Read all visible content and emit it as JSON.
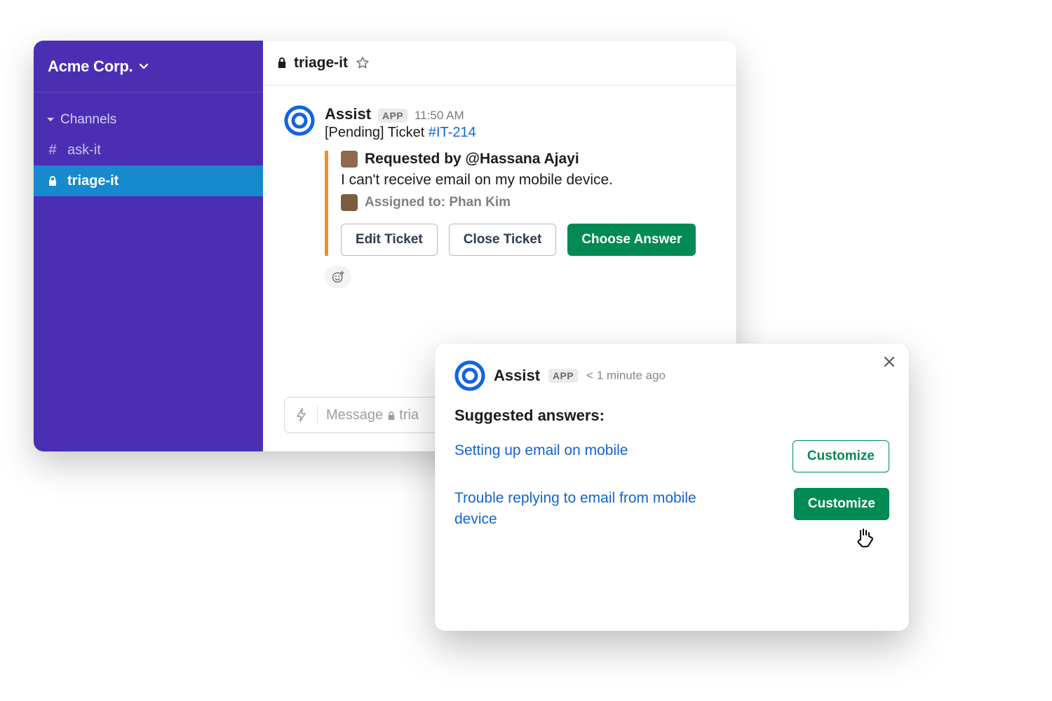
{
  "workspace": {
    "name": "Acme Corp."
  },
  "sidebar": {
    "section_label": "Channels",
    "channels": [
      {
        "name": "ask-it",
        "type": "public"
      },
      {
        "name": "triage-it",
        "type": "private"
      }
    ]
  },
  "channel_header": {
    "name": "triage-it"
  },
  "message": {
    "author": "Assist",
    "badge": "APP",
    "time": "11:50 AM",
    "status_prefix": "[Pending] Ticket ",
    "ticket_id": "#IT-214",
    "requested_label": "Requested by ",
    "requested_by": "@Hassana Ajayi",
    "issue": "I can't receive email on my mobile device.",
    "assigned_label": "Assigned to: ",
    "assigned_to": "Phan Kim",
    "buttons": {
      "edit": "Edit Ticket",
      "close": "Close Ticket",
      "choose": "Choose Answer"
    }
  },
  "composer": {
    "placeholder_prefix": "Message ",
    "placeholder_channel_partial": "tria"
  },
  "modal": {
    "author": "Assist",
    "badge": "APP",
    "time": "< 1 minute ago",
    "heading": "Suggested answers:",
    "answers": [
      {
        "text": "Setting up email on mobile",
        "button": "Customize"
      },
      {
        "text": "Trouble replying to email from mobile device",
        "button": "Customize"
      }
    ]
  }
}
